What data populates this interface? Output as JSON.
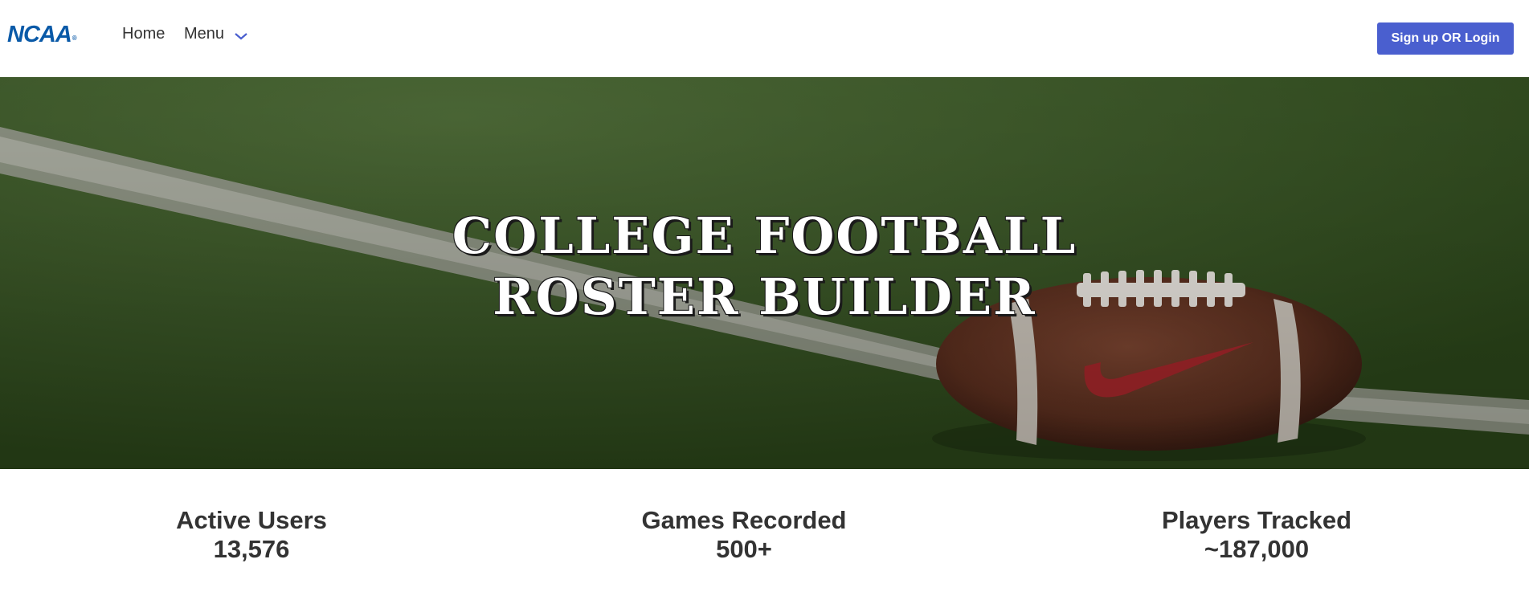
{
  "header": {
    "logo_text": "NCAA",
    "logo_mark": "®",
    "nav": {
      "home_label": "Home",
      "menu_label": "Menu"
    },
    "login_label": "Sign up OR Login"
  },
  "hero": {
    "title_line1": "COLLEGE FOOTBALL",
    "title_line2": "ROSTER BUILDER",
    "background": "football-on-turf-photo"
  },
  "stats": [
    {
      "label": "Active Users",
      "value": "13,576"
    },
    {
      "label": "Games Recorded",
      "value": "500+"
    },
    {
      "label": "Players Tracked",
      "value": "~187,000"
    }
  ],
  "colors": {
    "brand_blue": "#0a5aa8",
    "button_bg": "#4a5fcf",
    "text": "#333333"
  }
}
